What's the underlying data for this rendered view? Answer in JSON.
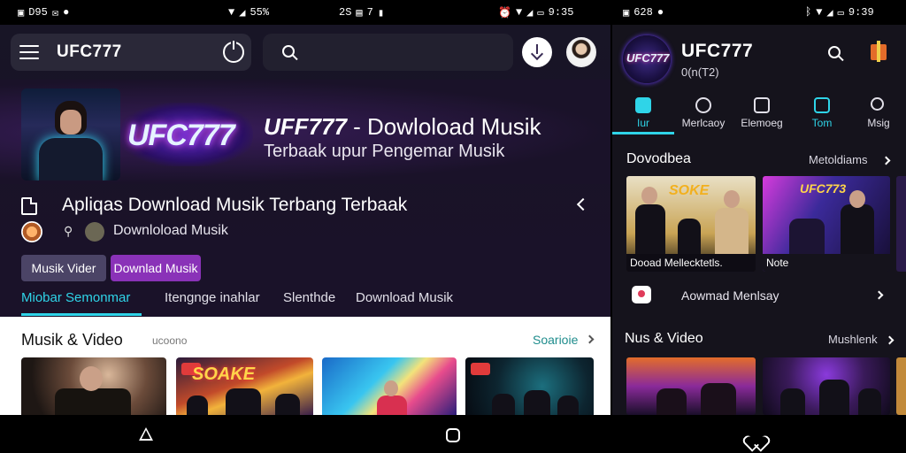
{
  "status_left": {
    "left_text": "D95",
    "mid_text": "55%",
    "time_mid": "2S",
    "time_b": "7",
    "right_text": "9:35"
  },
  "status_right": {
    "left_text": "628",
    "right_text": "9:39"
  },
  "left": {
    "app_title": "UFC777",
    "hero": {
      "logo_text": "UFC777",
      "title_brand": "UFF777",
      "title_rest": " - Dowloload Musik",
      "subtitle": "Terbaak upur Pengemar Musik"
    },
    "app_name": "Apliqas Download Musik Terbang Terbaak",
    "app_sub": "Downloload Musik",
    "chips": [
      "Musik Vider",
      "Downlad Musik"
    ],
    "tabs": [
      "Miobar Semonmar",
      "Itengnge inahlar",
      "Slenthde",
      "Download Musik"
    ],
    "section": {
      "title": "Musik & Video",
      "subtitle": "ucoono",
      "see_all": "Soarioie"
    },
    "thumb_texts": [
      "SOAKE"
    ]
  },
  "right": {
    "title": "UFC777",
    "subtitle": "0(n(T2)",
    "tabs": [
      "Iur",
      "Merlcaoy",
      "Elemoeg",
      "Tom",
      "Msig"
    ],
    "section1": {
      "title": "Dovodbea",
      "link": "Metoldiams"
    },
    "cards": [
      {
        "caption": "Dooad Mellecktetls.",
        "overlay": "SOKE"
      },
      {
        "caption": "Note",
        "overlay": "UFC773"
      }
    ],
    "row2_label": "Aowmad Menlsay",
    "section2": {
      "title": "Nus & Video",
      "link": "Mushlenk"
    }
  },
  "colors": {
    "accent": "#2fd4e8",
    "chip_purple": "#8a32b8",
    "chip_gray": "#4b4466",
    "bg_dark": "#1a1229"
  }
}
